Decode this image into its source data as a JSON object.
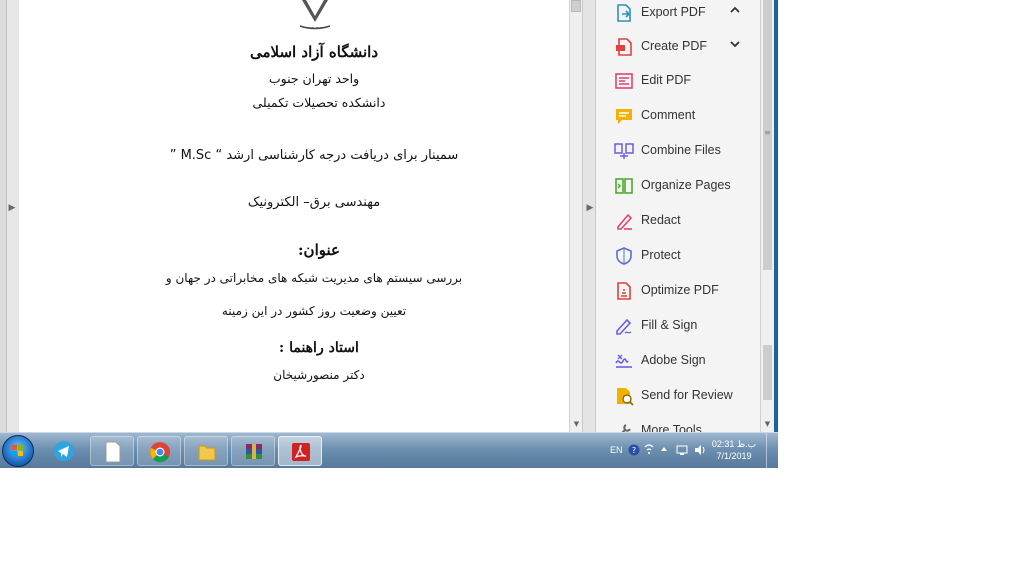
{
  "document": {
    "title_line1": "دانشگاه آزاد اسلامی",
    "title_line2": "واحد تهران جنوب",
    "title_line3": "دانشکده تحصیلات تکمیلی",
    "seminar_line": "سمینار برای دریافت درجه کارشناسی ارشد “ M.Sc ”",
    "field": "مهندسی برق– الکترونیک",
    "subject_heading": "عنوان:",
    "subject_line1": "بررسی سیستم های مدیریت شبکه های مخابراتی در جهان و",
    "subject_line2": "تعیین  وضعیت روز کشور در این زمینه",
    "advisor_heading": "استاد راهنما :",
    "advisor_name": "دکتر منصورشیخان"
  },
  "tools": [
    {
      "label": "Export PDF",
      "icon": "export-pdf-icon",
      "color": "#2e8fbf",
      "chevron": "up"
    },
    {
      "label": "Create PDF",
      "icon": "create-pdf-icon",
      "color": "#e0423f",
      "chevron": "down"
    },
    {
      "label": "Edit PDF",
      "icon": "edit-pdf-icon",
      "color": "#e0427a"
    },
    {
      "label": "Comment",
      "icon": "comment-icon",
      "color": "#f2b100"
    },
    {
      "label": "Combine Files",
      "icon": "combine-files-icon",
      "color": "#6a5fe0"
    },
    {
      "label": "Organize Pages",
      "icon": "organize-pages-icon",
      "color": "#4caa2e"
    },
    {
      "label": "Redact",
      "icon": "redact-icon",
      "color": "#e0427a"
    },
    {
      "label": "Protect",
      "icon": "protect-icon",
      "color": "#5a6fd0"
    },
    {
      "label": "Optimize PDF",
      "icon": "optimize-pdf-icon",
      "color": "#e0423f"
    },
    {
      "label": "Fill & Sign",
      "icon": "fill-sign-icon",
      "color": "#6a5fe0"
    },
    {
      "label": "Adobe Sign",
      "icon": "adobe-sign-icon",
      "color": "#6a5fe0"
    },
    {
      "label": "Send for Review",
      "icon": "send-for-review-icon",
      "color": "#f2b100"
    },
    {
      "label": "More Tools",
      "icon": "more-tools-icon",
      "color": "#666666"
    }
  ],
  "taskbar": {
    "apps": [
      "telegram-icon",
      "file-icon",
      "chrome-icon",
      "folder-icon",
      "winrar-icon",
      "acrobat-icon"
    ],
    "lang": "EN",
    "time": "02:31 ب.ظ",
    "date": "7/1/2019"
  },
  "colors": {
    "taskbar": "#6d8fb0",
    "accent": "#1b63a8"
  }
}
